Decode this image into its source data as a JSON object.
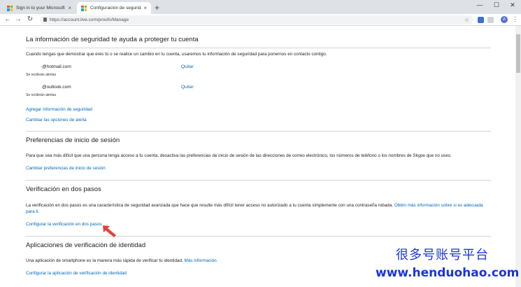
{
  "browser": {
    "tabs": [
      {
        "title": "Sign in to your Microsoft accou",
        "close": "×"
      },
      {
        "title": "Configuración de seguridad",
        "close": "×"
      }
    ],
    "new_tab": "+",
    "window_controls": {
      "minimize": "—",
      "maximize": "☐",
      "close": "✕"
    },
    "nav": {
      "back": "←",
      "forward": "→",
      "reload": "↻"
    },
    "url": "https://account.live.com/proofs/Manage",
    "bookmark": "☆",
    "avatar_letter": "A",
    "menu": "⋮",
    "colors": {
      "ms_red": "#f25022",
      "ms_green": "#7fba00",
      "ms_blue": "#00a4ef",
      "ms_yellow": "#ffb900"
    }
  },
  "security_info": {
    "heading": "La información de seguridad te ayuda a proteger tu cuenta",
    "description": "Cuando tengas que demostrar que eres tú o se realice un cambio en tu cuenta, usaremos tu información de seguridad para ponernos en contacto contigo.",
    "items": [
      {
        "email": "·@hotmail.com",
        "note": "Se recibirán alertas",
        "action": "Quitar"
      },
      {
        "email": "@outlook.com",
        "note": "Se recibirán alertas",
        "action": "Quitar"
      }
    ],
    "add_link": "Agregar información de seguridad",
    "alerts_link": "Cambiar las opciones de alerta"
  },
  "signin_prefs": {
    "heading": "Preferencias de inicio de sesión",
    "description": "Para que sea más difícil que una persona tenga acceso a tu cuenta, desactiva las preferencias de inicio de sesión de las direcciones de correo electrónico, los números de teléfono o los nombres de Skype que no uses.",
    "link": "Cambiar preferencias de inicio de sesión"
  },
  "two_step": {
    "heading": "Verificación en dos pasos",
    "description": "La verificación en dos pasos es una característica de seguridad avanzada que hace que resulte más difícil tener acceso no autorizado a tu cuenta simplemente con una contraseña robada.",
    "more_link": "Obtén más información sobre si es adecuada para ti.",
    "setup_link": "Configurar la verificación en dos pasos"
  },
  "identity_apps": {
    "heading": "Aplicaciones de verificación de identidad",
    "description": "Una aplicación de smartphone es la manera más rápida de verificar tu identidad.",
    "more_link": "Más información.",
    "setup_link": "Configurar la aplicación de verificación de identidad"
  },
  "watermark": {
    "line1": "很多号账号平台",
    "line2": "www.henduohao.com"
  },
  "annotation_color": "#e8403a"
}
